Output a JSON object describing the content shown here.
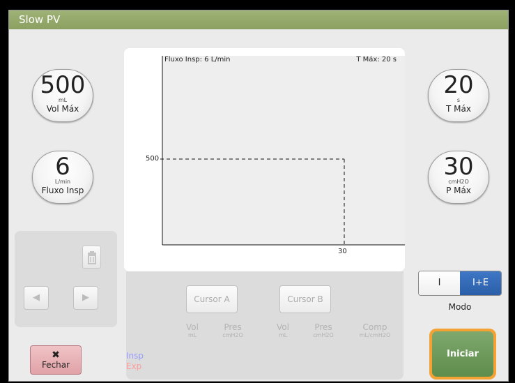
{
  "window": {
    "title": "Slow PV"
  },
  "controls": {
    "vol_max": {
      "value": "500",
      "unit": "mL",
      "label": "Vol Máx"
    },
    "fluxo_insp": {
      "value": "6",
      "unit": "L/min",
      "label": "Fluxo Insp"
    },
    "t_max": {
      "value": "20",
      "unit": "s",
      "label": "T Máx"
    },
    "p_max": {
      "value": "30",
      "unit": "cmH2O",
      "label": "P Máx"
    }
  },
  "plot": {
    "info_left": "Fluxo Insp:  6 L/min",
    "info_right": "T Máx:  20 s",
    "y_tick": "500",
    "x_tick": "30"
  },
  "chart_data": {
    "type": "line",
    "x_limit_marker": 30,
    "y_limit_marker": 500,
    "series": []
  },
  "cursors": {
    "cursor_a": "Cursor A",
    "cursor_b": "Cursor B",
    "columns": [
      {
        "name": "Vol",
        "unit": "mL"
      },
      {
        "name": "Pres",
        "unit": "cmH2O"
      },
      {
        "name": "Vol",
        "unit": "mL"
      },
      {
        "name": "Pres",
        "unit": "cmH2O"
      },
      {
        "name": "Comp",
        "unit": "mL/cmH2O"
      }
    ],
    "legend_insp": "Insp",
    "legend_exp": "Exp"
  },
  "nav": {
    "prev": "◀",
    "next": "▶"
  },
  "buttons": {
    "close": "Fechar",
    "close_glyph": "✖",
    "start": "Iniciar"
  },
  "mode": {
    "label": "Modo",
    "options": [
      "I",
      "I+E"
    ],
    "selected": "I+E"
  },
  "colors": {
    "titlebar": "#98ac70",
    "selected_mode": "#2f66b3",
    "start": "#6f9a5d",
    "start_ring": "#f3a233",
    "close": "#e8b3b7",
    "insp": "#9b9bff",
    "exp": "#ff9b9b"
  }
}
